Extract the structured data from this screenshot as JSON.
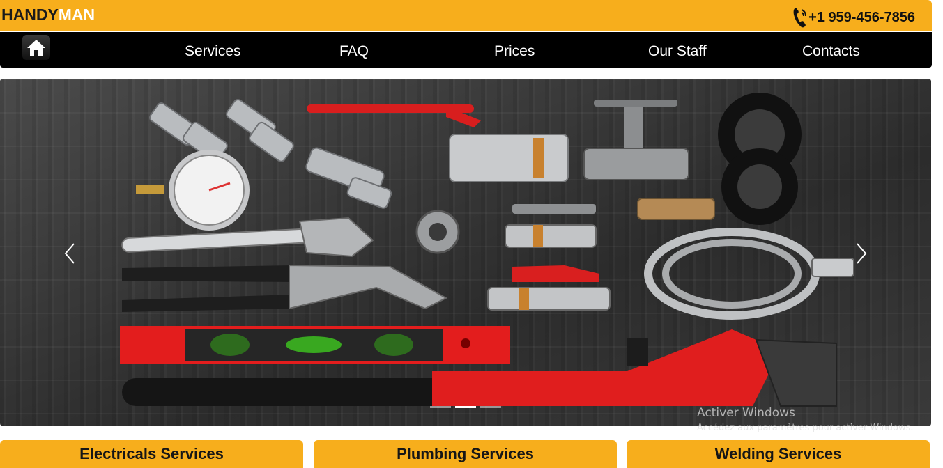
{
  "header": {
    "logo_part1": "HANDY",
    "logo_part2": "MAN",
    "phone": "+1 959-456-7856",
    "phone_icon": "phone-icon",
    "accent_color": "#f7ae1c"
  },
  "nav": {
    "home_icon": "home-icon",
    "items": [
      "Services",
      "FAQ",
      "Prices",
      "Our Staff",
      "Contacts"
    ]
  },
  "carousel": {
    "image": "plumbing-tools-photo",
    "prev_icon": "chevron-left-icon",
    "next_icon": "chevron-right-icon",
    "indicator_count": 3,
    "active_index": 1
  },
  "watermark": {
    "line1": "Activer Windows",
    "line2": "Accédez aux paramètres pour activer Windows."
  },
  "services": [
    "Electricals Services",
    "Plumbing Services",
    "Welding Services"
  ]
}
